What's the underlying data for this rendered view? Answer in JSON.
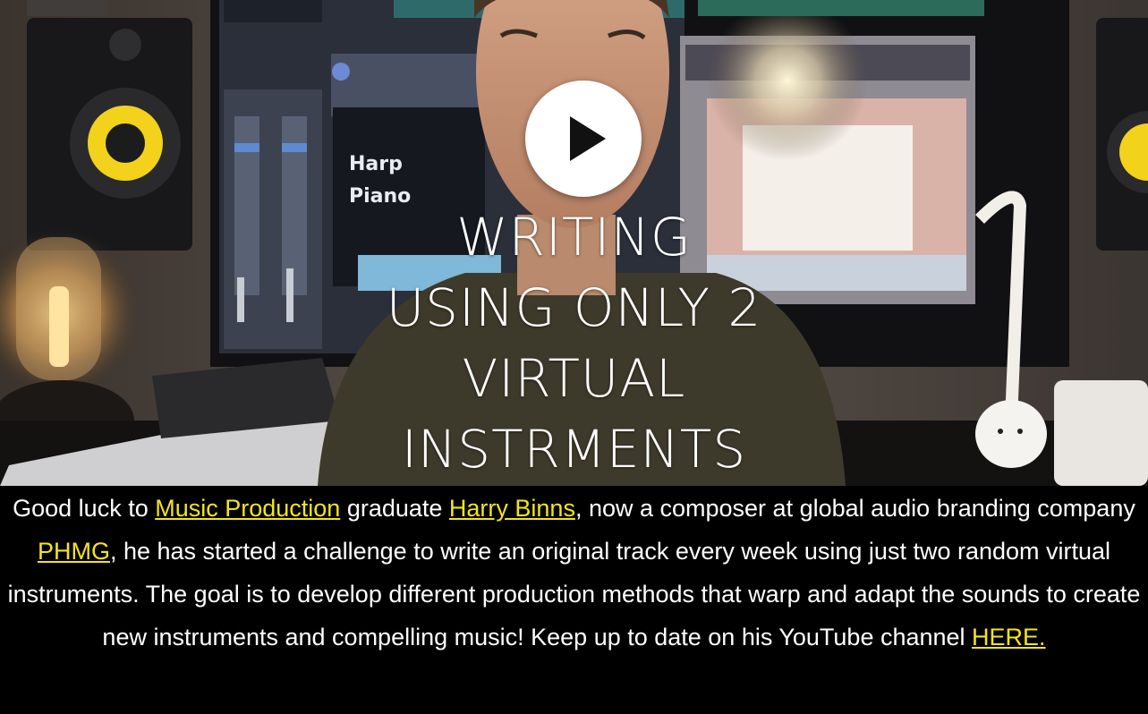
{
  "video": {
    "title_lines": [
      "WRITING",
      "USING ONLY 2",
      "VIRTUAL",
      "INSTRMENTS"
    ],
    "screen_labels": [
      "Harp",
      "Piano"
    ],
    "play_icon": "play-icon"
  },
  "caption": {
    "t1": "Good luck to ",
    "link_music_production": "Music Production",
    "t2": " graduate ",
    "link_harry_binns": "Harry Binns",
    "t3": ", now a composer at global audio branding company ",
    "link_phmg": "PHMG",
    "t4": ", he has started a challenge to write an original track every week using just two random virtual instruments. The goal is to develop different production methods that warp and adapt the sounds to create new instruments and compelling music! Keep up to date on his YouTube channel ",
    "link_here": "HERE."
  },
  "colors": {
    "link": "#f2e51f",
    "background": "#000000",
    "speaker_cone": "#f2d21b"
  }
}
